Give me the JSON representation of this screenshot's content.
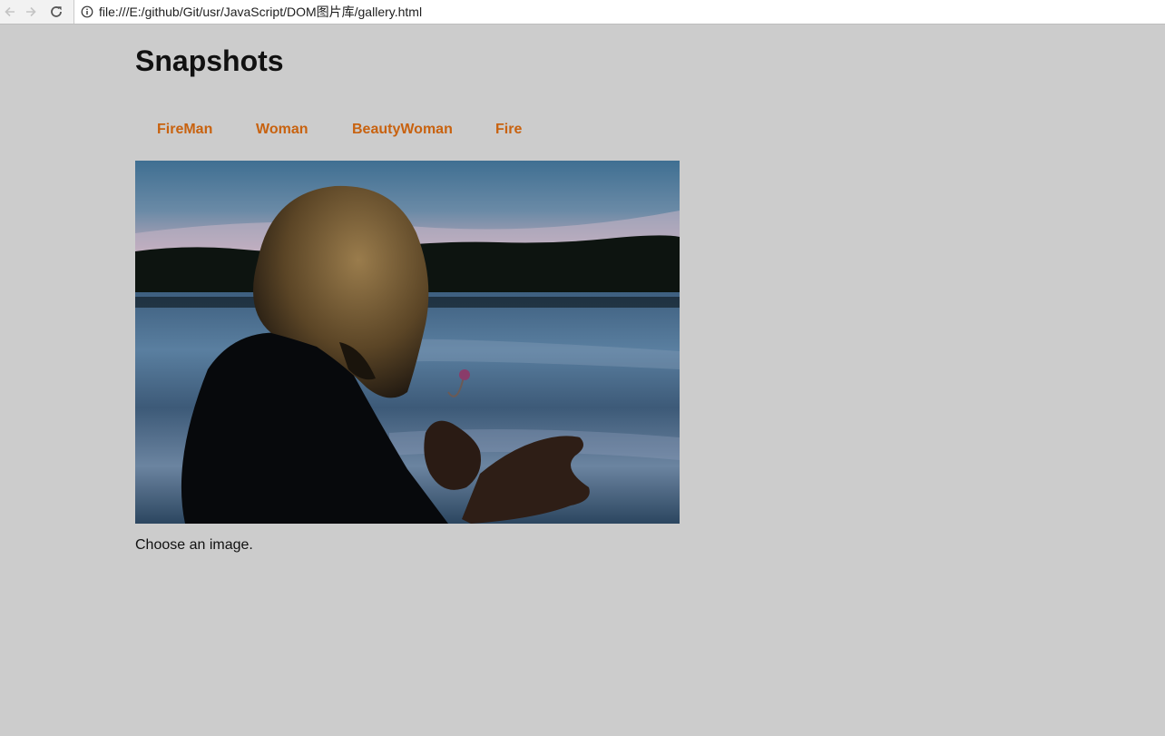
{
  "browser": {
    "url": "file:///E:/github/Git/usr/JavaScript/DOM图片库/gallery.html"
  },
  "page": {
    "title": "Snapshots",
    "links": [
      {
        "label": "FireMan"
      },
      {
        "label": "Woman"
      },
      {
        "label": "BeautyWoman"
      },
      {
        "label": "Fire"
      }
    ],
    "description": "Choose an image.",
    "link_color": "#c8620f",
    "background_color": "#cccccc"
  }
}
